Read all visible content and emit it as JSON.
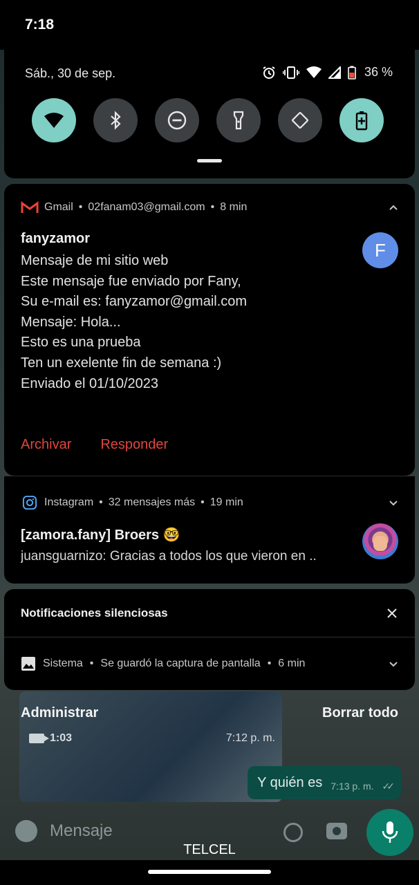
{
  "status_bar": {
    "time": "7:18",
    "carrier": "TELCEL"
  },
  "quick_settings": {
    "date": "Sáb., 30 de sep.",
    "battery_percent": "36 %",
    "status_icons": [
      "alarm-icon",
      "vibrate-icon",
      "wifi-signal-icon",
      "cell-signal-icon",
      "battery-icon"
    ],
    "tiles": [
      {
        "name": "wifi",
        "icon": "wifi-icon",
        "active": true
      },
      {
        "name": "bluetooth",
        "icon": "bluetooth-icon",
        "active": false
      },
      {
        "name": "do-not-disturb",
        "icon": "do-not-disturb-icon",
        "active": false
      },
      {
        "name": "flashlight",
        "icon": "flashlight-icon",
        "active": false
      },
      {
        "name": "auto-rotate",
        "icon": "rotate-icon",
        "active": false
      },
      {
        "name": "battery-saver",
        "icon": "battery-saver-icon",
        "active": true
      }
    ]
  },
  "gmail": {
    "app": "Gmail",
    "account": "02fanam03@gmail.com",
    "time": "8 min",
    "title": "fanyzamor",
    "avatar_letter": "F",
    "lines": [
      "Mensaje de mi sitio web",
      "Este mensaje fue enviado por Fany,",
      "Su e-mail es: fanyzamor@gmail.com",
      "Mensaje: Hola...",
      "Esto es una prueba",
      "Ten un exelente fin de semana :)",
      "Enviado el 01/10/2023"
    ],
    "actions": {
      "archive": "Archivar",
      "reply": "Responder"
    }
  },
  "instagram": {
    "app": "Instagram",
    "count": "32 mensajes más",
    "time": "19 min",
    "title": "[zamora.fany] Broers 🤓",
    "body": "juansguarnizo: Gracias a todos los que vieron en .."
  },
  "silent": {
    "title": "Notificaciones silenciosas",
    "system": {
      "app": "Sistema",
      "text": "Se guardó la captura de pantalla",
      "time": "6 min"
    }
  },
  "footer": {
    "manage": "Administrar",
    "clear_all": "Borrar todo"
  },
  "chat_background": {
    "video_duration": "1:03",
    "video_time": "7:12 p. m.",
    "bubble_text": "Y quién es",
    "bubble_time": "7:13 p. m.",
    "composer_placeholder": "Mensaje"
  },
  "colors": {
    "accent_teal": "#7fcfc4",
    "action_red": "#e0463f",
    "gmail_avatar": "#5f8de8"
  }
}
